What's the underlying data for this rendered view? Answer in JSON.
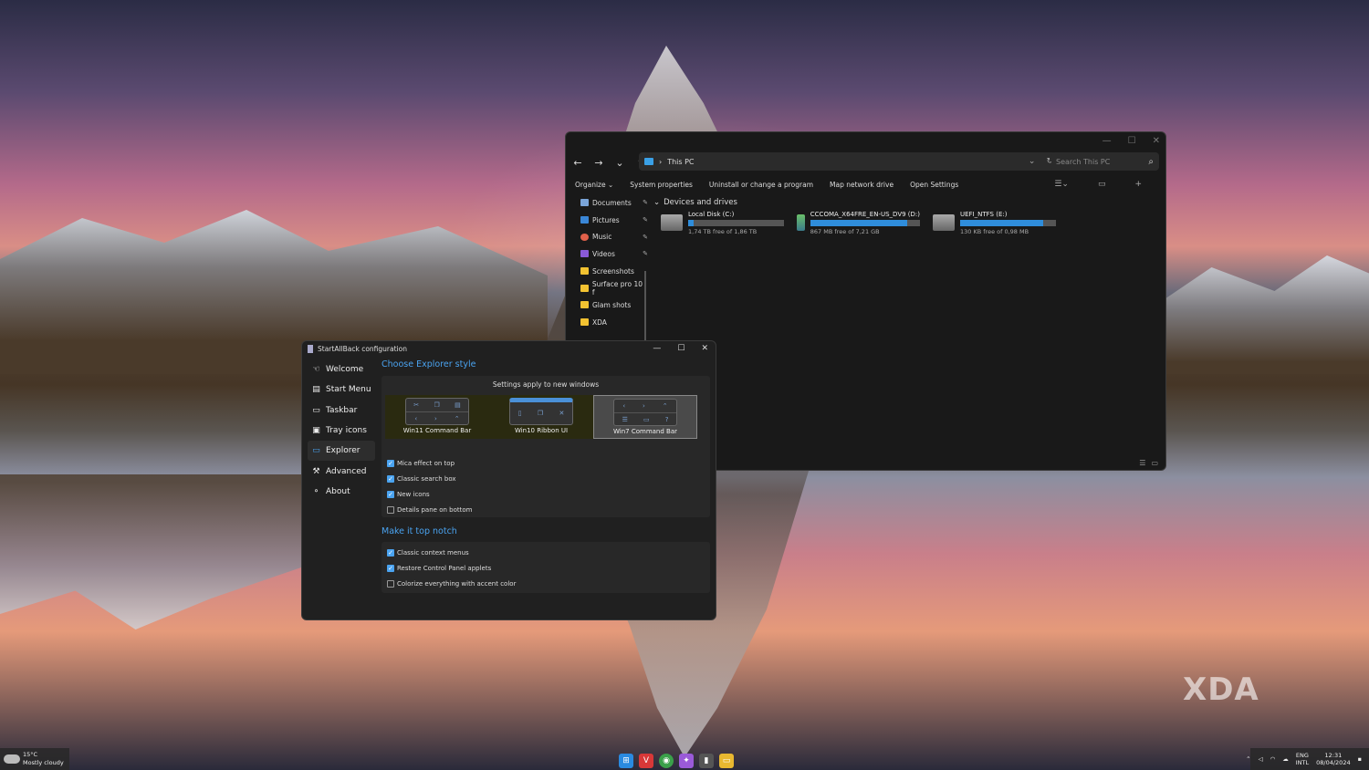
{
  "explorer": {
    "address": "This PC",
    "search_placeholder": "Search This PC",
    "command_bar": [
      "Organize ⌄",
      "System properties",
      "Uninstall or change a program",
      "Map network drive",
      "Open Settings"
    ],
    "sidebar": [
      {
        "label": "Documents",
        "icon": "documents-icon",
        "color": "#7aa4d8",
        "pinned": true
      },
      {
        "label": "Pictures",
        "icon": "pictures-icon",
        "color": "#3a86d6",
        "pinned": true
      },
      {
        "label": "Music",
        "icon": "music-icon",
        "color": "#e0604a",
        "pinned": true
      },
      {
        "label": "Videos",
        "icon": "videos-icon",
        "color": "#8a5ad8",
        "pinned": true
      },
      {
        "label": "Screenshots",
        "icon": "folder-icon",
        "color": "#f2c231",
        "pinned": false
      },
      {
        "label": "Surface pro 10 f",
        "icon": "folder-icon",
        "color": "#f2c231",
        "pinned": false
      },
      {
        "label": "Glam shots",
        "icon": "folder-icon",
        "color": "#f2c231",
        "pinned": false
      },
      {
        "label": "XDA",
        "icon": "folder-icon",
        "color": "#f2c231",
        "pinned": false
      }
    ],
    "group_title": "Devices and drives",
    "drives": [
      {
        "name": "Local Disk (C:)",
        "free": "1,74 TB free of 1,86 TB",
        "used_fraction": 0.06
      },
      {
        "name": "CCCOMA_X64FRE_EN-US_DV9 (D:)",
        "free": "867 MB free of 7,21 GB",
        "used_fraction": 0.88
      },
      {
        "name": "UEFI_NTFS (E:)",
        "free": "130 KB free of 0,98 MB",
        "used_fraction": 0.87
      }
    ]
  },
  "sab": {
    "title": "StartAllBack configuration",
    "nav": [
      {
        "label": "Welcome",
        "icon": "hand-wave-icon"
      },
      {
        "label": "Start Menu",
        "icon": "start-menu-icon"
      },
      {
        "label": "Taskbar",
        "icon": "taskbar-icon"
      },
      {
        "label": "Tray icons",
        "icon": "tray-icon"
      },
      {
        "label": "Explorer",
        "icon": "folder-icon",
        "active": true
      },
      {
        "label": "Advanced",
        "icon": "wrench-icon"
      },
      {
        "label": "About",
        "icon": "about-icon"
      }
    ],
    "explorer_heading": "Choose Explorer style",
    "apply_note": "Settings apply to new windows",
    "styles": [
      "Win11 Command Bar",
      "Win10 Ribbon UI",
      "Win7 Command Bar"
    ],
    "selected_style": "Win7 Command Bar",
    "options": [
      {
        "label": "Mica effect on top",
        "checked": true
      },
      {
        "label": "Classic search box",
        "checked": true
      },
      {
        "label": "New icons",
        "checked": true
      },
      {
        "label": "Details pane on bottom",
        "checked": false
      }
    ],
    "notch_heading": "Make it top notch",
    "notch_options": [
      {
        "label": "Classic context menus",
        "checked": true
      },
      {
        "label": "Restore Control Panel applets",
        "checked": true
      },
      {
        "label": "Colorize everything with accent color",
        "checked": false
      }
    ]
  },
  "taskbar": {
    "weather_temp": "15°C",
    "weather_desc": "Mostly cloudy",
    "lang_1": "ENG",
    "lang_2": "INTL",
    "time": "12:31",
    "date": "08/04/2024"
  },
  "watermark": "XDA"
}
